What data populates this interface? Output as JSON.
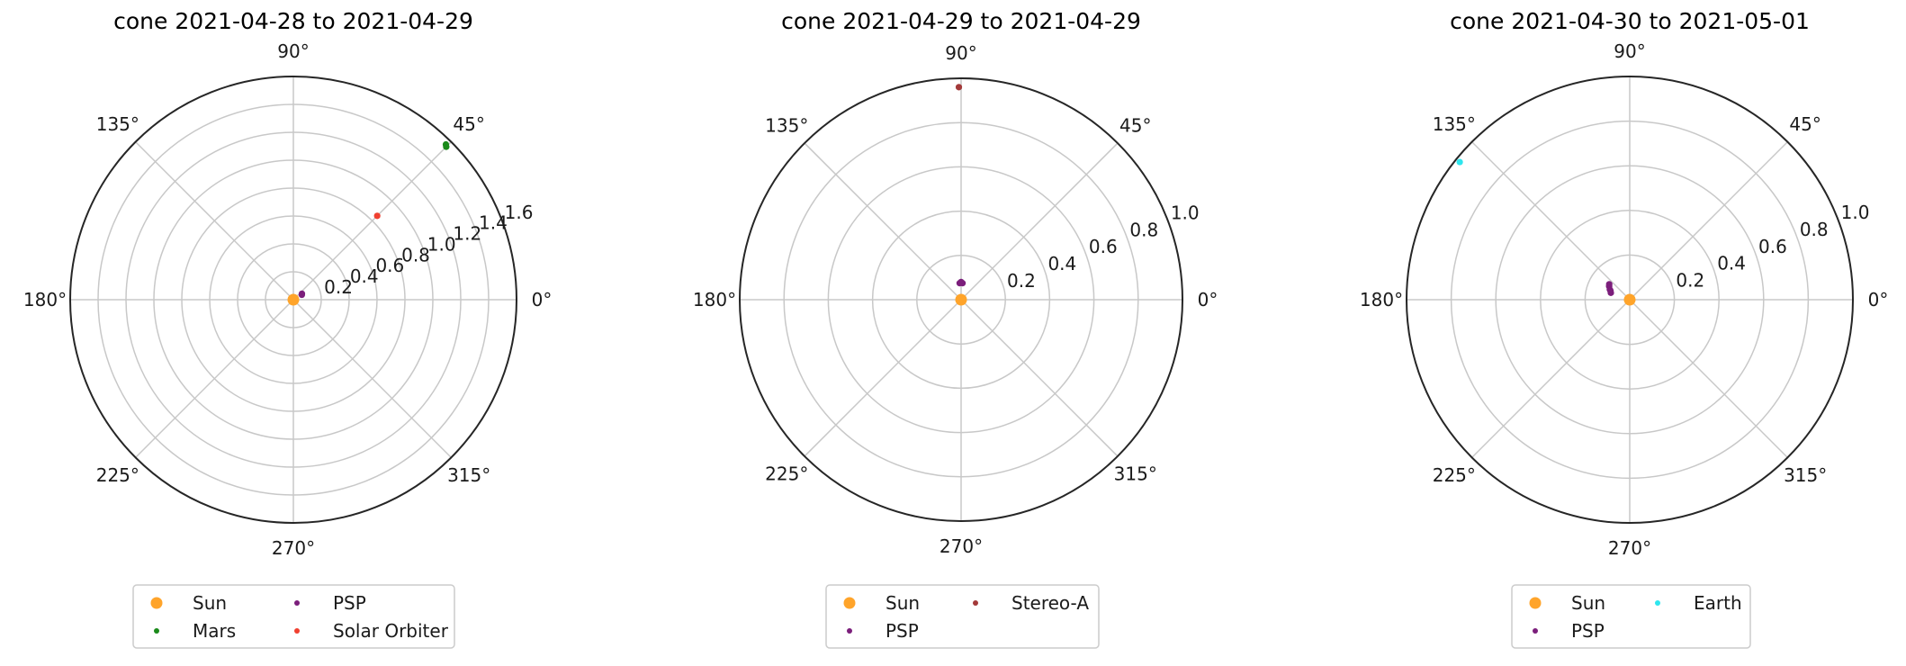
{
  "chart_data": [
    {
      "type": "scatter",
      "projection": "polar",
      "title": "cone 2021-04-28 to 2021-04-29",
      "theta_tick_labels": [
        "0°",
        "45°",
        "90°",
        "135°",
        "180°",
        "225°",
        "270°",
        "315°"
      ],
      "r_ticks": [
        0.2,
        0.4,
        0.6,
        0.8,
        1.0,
        1.2,
        1.4,
        1.6
      ],
      "r_tick_labels": [
        "0.2",
        "0.4",
        "0.6",
        "0.8",
        "1.0",
        "1.2",
        "1.4",
        "1.6"
      ],
      "rlim": [
        0,
        1.6
      ],
      "grid": true,
      "legend_placement": "bottom",
      "series": [
        {
          "name": "Sun",
          "color": "#ffa42a",
          "marker": "large",
          "points": [
            {
              "theta": 0,
              "r": 0
            }
          ]
        },
        {
          "name": "PSP",
          "color": "#7b1e7b",
          "marker": "small",
          "points": [
            {
              "theta": 30,
              "r": 0.07
            },
            {
              "theta": 35,
              "r": 0.075
            }
          ]
        },
        {
          "name": "Mars",
          "color": "#1a8a1a",
          "marker": "small",
          "points": [
            {
              "theta": 45,
              "r": 1.55
            },
            {
              "theta": 45.5,
              "r": 1.56
            }
          ]
        },
        {
          "name": "Solar Orbiter",
          "color": "#f04030",
          "marker": "small",
          "points": [
            {
              "theta": 45,
              "r": 0.85
            }
          ]
        }
      ]
    },
    {
      "type": "scatter",
      "projection": "polar",
      "title": "cone 2021-04-29 to 2021-04-29",
      "theta_tick_labels": [
        "0°",
        "45°",
        "90°",
        "135°",
        "180°",
        "225°",
        "270°",
        "315°"
      ],
      "r_ticks": [
        0.2,
        0.4,
        0.6,
        0.8,
        1.0
      ],
      "r_tick_labels": [
        "0.2",
        "0.4",
        "0.6",
        "0.8",
        "1.0"
      ],
      "rlim": [
        0,
        1.0
      ],
      "grid": true,
      "legend_placement": "bottom",
      "series": [
        {
          "name": "Sun",
          "color": "#ffa42a",
          "marker": "large",
          "points": [
            {
              "theta": 0,
              "r": 0
            }
          ]
        },
        {
          "name": "Stereo-A",
          "color": "#a33a3a",
          "marker": "small",
          "points": [
            {
              "theta": 90.6,
              "r": 0.96
            }
          ]
        },
        {
          "name": "PSP",
          "color": "#7b1e7b",
          "marker": "small",
          "points": [
            {
              "theta": 85,
              "r": 0.075
            },
            {
              "theta": 90,
              "r": 0.08
            },
            {
              "theta": 95,
              "r": 0.075
            }
          ]
        }
      ]
    },
    {
      "type": "scatter",
      "projection": "polar",
      "title": "cone 2021-04-30 to 2021-05-01",
      "theta_tick_labels": [
        "0°",
        "45°",
        "90°",
        "135°",
        "180°",
        "225°",
        "270°",
        "315°"
      ],
      "r_ticks": [
        0.2,
        0.4,
        0.6,
        0.8,
        1.0
      ],
      "r_tick_labels": [
        "0.2",
        "0.4",
        "0.6",
        "0.8",
        "1.0"
      ],
      "rlim": [
        0,
        1.0
      ],
      "grid": true,
      "legend_placement": "bottom",
      "series": [
        {
          "name": "Sun",
          "color": "#ffa42a",
          "marker": "large",
          "points": [
            {
              "theta": 0,
              "r": 0
            }
          ]
        },
        {
          "name": "Earth",
          "color": "#2ee6ee",
          "marker": "small",
          "points": [
            {
              "theta": 141,
              "r": 0.98
            }
          ]
        },
        {
          "name": "PSP",
          "color": "#7b1e7b",
          "marker": "small",
          "points": [
            {
              "theta": 160,
              "r": 0.09
            },
            {
              "theta": 153,
              "r": 0.1
            },
            {
              "theta": 147,
              "r": 0.11
            },
            {
              "theta": 143,
              "r": 0.115
            },
            {
              "theta": 155,
              "r": 0.095
            }
          ]
        }
      ]
    }
  ]
}
